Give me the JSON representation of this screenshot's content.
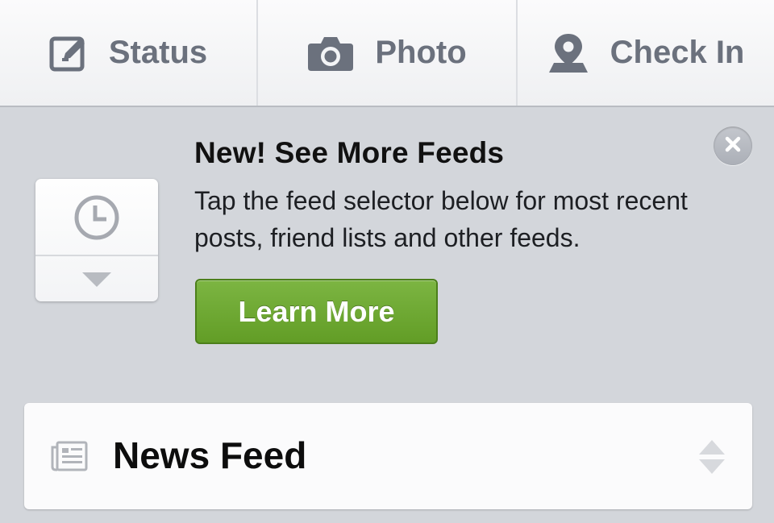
{
  "composer": {
    "status_label": "Status",
    "photo_label": "Photo",
    "checkin_label": "Check In",
    "icons": [
      "compose-icon",
      "camera-icon",
      "location-pin-icon"
    ],
    "text_color": "#6b717d"
  },
  "promo": {
    "title": "New! See More Feeds",
    "body": "Tap the feed selector below for most recent posts, friend lists and other feeds.",
    "cta_label": "Learn More",
    "cta_color": "#6aa52f",
    "icons": [
      "close-icon",
      "clock-icon",
      "caret-down-icon"
    ]
  },
  "feed_selector": {
    "label": "News Feed",
    "icons": [
      "news-feed-icon",
      "sort-arrows-icon"
    ]
  },
  "colors": {
    "background": "#d3d6db",
    "bar": "#f4f5f6"
  }
}
